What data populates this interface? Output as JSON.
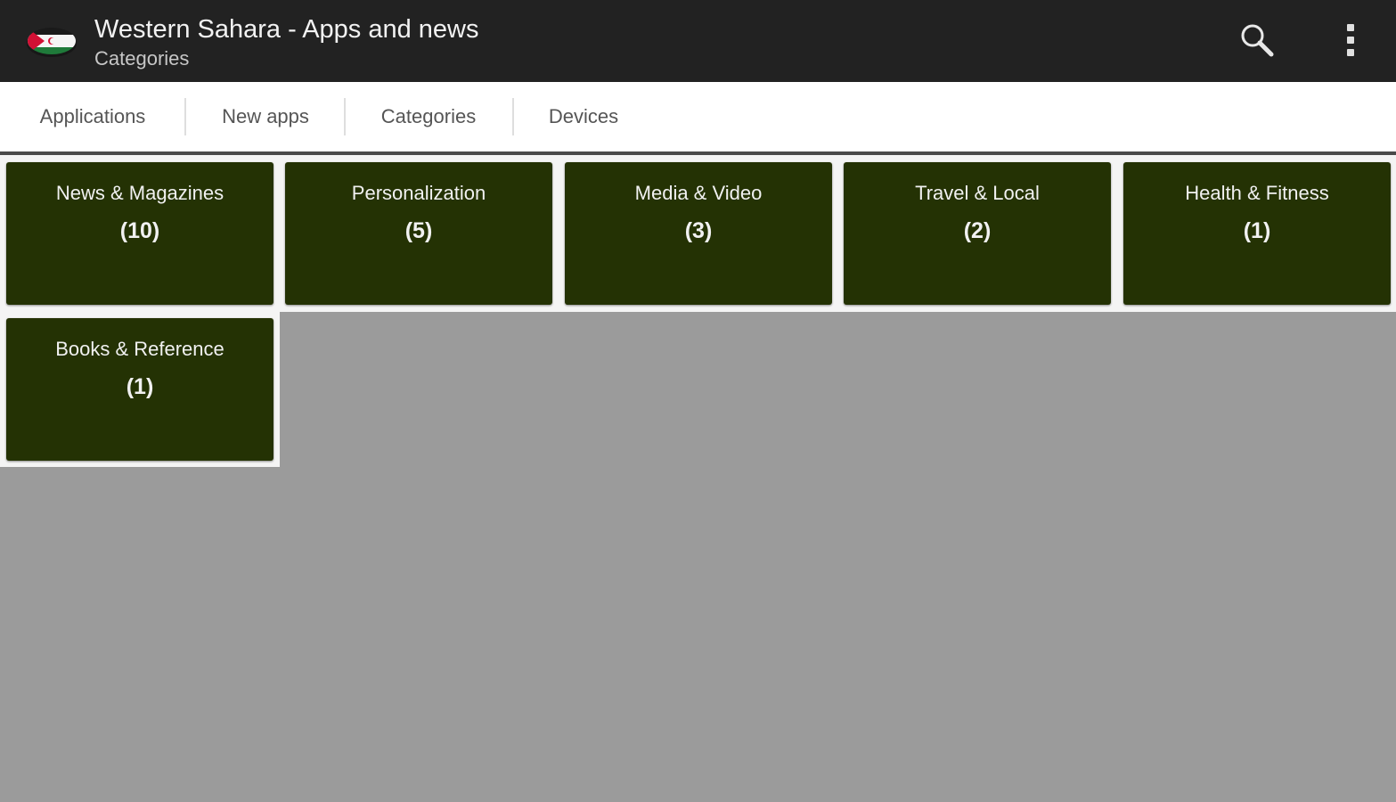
{
  "header": {
    "title": "Western Sahara - Apps and news",
    "subtitle": "Categories",
    "app_icon": "western-sahara-flag-icon",
    "search_icon": "search-icon",
    "overflow_icon": "more-vertical-icon"
  },
  "tabs": [
    {
      "label": "Applications"
    },
    {
      "label": "New apps"
    },
    {
      "label": "Categories"
    },
    {
      "label": "Devices"
    }
  ],
  "categories": [
    {
      "name": "News & Magazines",
      "count": "(10)"
    },
    {
      "name": "Personalization",
      "count": "(5)"
    },
    {
      "name": "Media & Video",
      "count": "(3)"
    },
    {
      "name": "Travel & Local",
      "count": "(2)"
    },
    {
      "name": "Health & Fitness",
      "count": "(1)"
    },
    {
      "name": "Books & Reference",
      "count": "(1)"
    }
  ],
  "colors": {
    "action_bar": "#222222",
    "tile": "#243204",
    "background": "#9b9b9b"
  }
}
